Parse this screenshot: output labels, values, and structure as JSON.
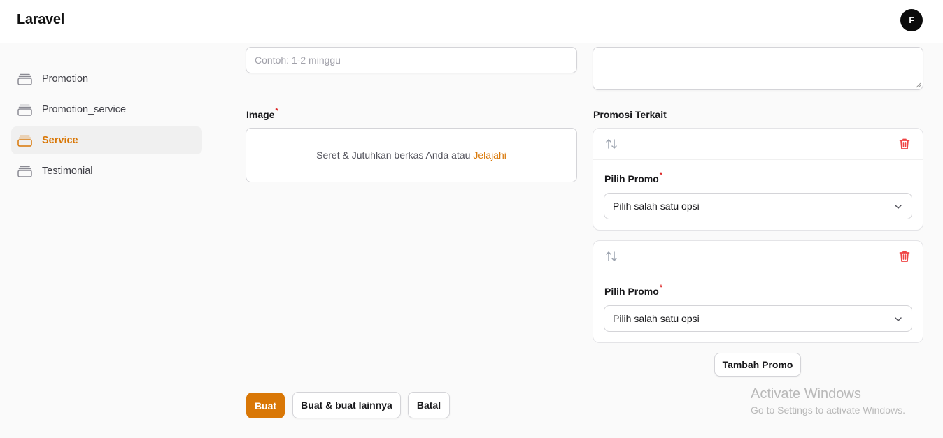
{
  "app": {
    "title": "Laravel",
    "avatar_initial": "F"
  },
  "sidebar": {
    "items": [
      {
        "label": "Promotion",
        "icon": "stack-icon",
        "active": false
      },
      {
        "label": "Promotion_service",
        "icon": "stack-icon",
        "active": false
      },
      {
        "label": "Service",
        "icon": "stack-icon",
        "active": true
      },
      {
        "label": "Testimonial",
        "icon": "stack-icon",
        "active": false
      }
    ]
  },
  "form": {
    "duration_input": {
      "placeholder": "Contoh: 1-2 minggu",
      "value": ""
    },
    "image": {
      "label": "Image",
      "required_mark": "*",
      "dropzone_text": "Seret & Jutuhkan berkas Anda atau",
      "dropzone_link": "Jelajahi"
    },
    "related_promos": {
      "label": "Promosi Terkait",
      "items": [
        {
          "label": "Pilih Promo",
          "required_mark": "*",
          "select_value": "Pilih salah satu opsi"
        },
        {
          "label": "Pilih Promo",
          "required_mark": "*",
          "select_value": "Pilih salah satu opsi"
        }
      ],
      "add_button": "Tambah Promo"
    },
    "actions": {
      "create": "Buat",
      "create_another": "Buat & buat lainnya",
      "cancel": "Batal"
    }
  },
  "watermark": {
    "title": "Activate Windows",
    "subtitle": "Go to Settings to activate Windows."
  },
  "colors": {
    "accent": "#d97706",
    "danger": "#dc2626"
  }
}
